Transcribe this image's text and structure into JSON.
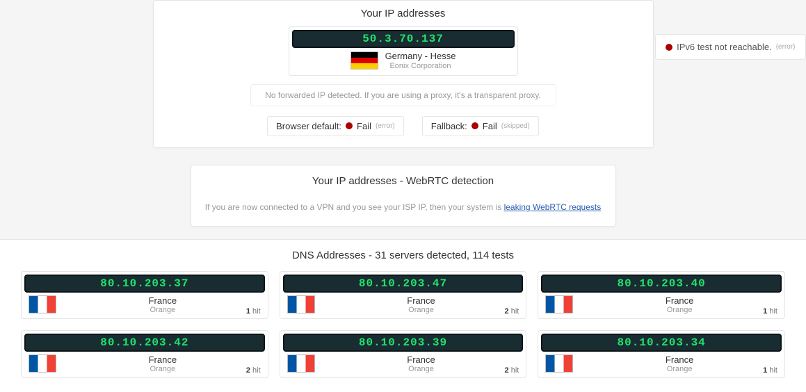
{
  "ip_section": {
    "title": "Your IP addresses",
    "ip": "50.3.70.137",
    "location": "Germany - Hesse",
    "isp": "Eonix Corporation",
    "flag": "de",
    "note": "No forwarded IP detected. If you are using a proxy, it's a transparent proxy.",
    "ipv6": {
      "text": "IPv6 test not reachable.",
      "status_note": "(error)"
    },
    "browser_default": {
      "label": "Browser default:",
      "status": "Fail",
      "note": "(error)"
    },
    "fallback": {
      "label": "Fallback:",
      "status": "Fail",
      "note": "(skipped)"
    }
  },
  "webrtc": {
    "title": "Your IP addresses - WebRTC detection",
    "text_prefix": "If you are now connected to a VPN and you see your ISP IP, then your system is ",
    "link_text": "leaking WebRTC requests"
  },
  "dns": {
    "title": "DNS Addresses - 31 servers detected, 114 tests",
    "servers": [
      {
        "ip": "80.10.203.37",
        "country": "France",
        "isp": "Orange",
        "flag": "fr",
        "hits": "1",
        "hit_label": "hit"
      },
      {
        "ip": "80.10.203.47",
        "country": "France",
        "isp": "Orange",
        "flag": "fr",
        "hits": "2",
        "hit_label": "hit"
      },
      {
        "ip": "80.10.203.40",
        "country": "France",
        "isp": "Orange",
        "flag": "fr",
        "hits": "1",
        "hit_label": "hit"
      },
      {
        "ip": "80.10.203.42",
        "country": "France",
        "isp": "Orange",
        "flag": "fr",
        "hits": "2",
        "hit_label": "hit"
      },
      {
        "ip": "80.10.203.39",
        "country": "France",
        "isp": "Orange",
        "flag": "fr",
        "hits": "2",
        "hit_label": "hit"
      },
      {
        "ip": "80.10.203.34",
        "country": "France",
        "isp": "Orange",
        "flag": "fr",
        "hits": "1",
        "hit_label": "hit"
      }
    ]
  }
}
